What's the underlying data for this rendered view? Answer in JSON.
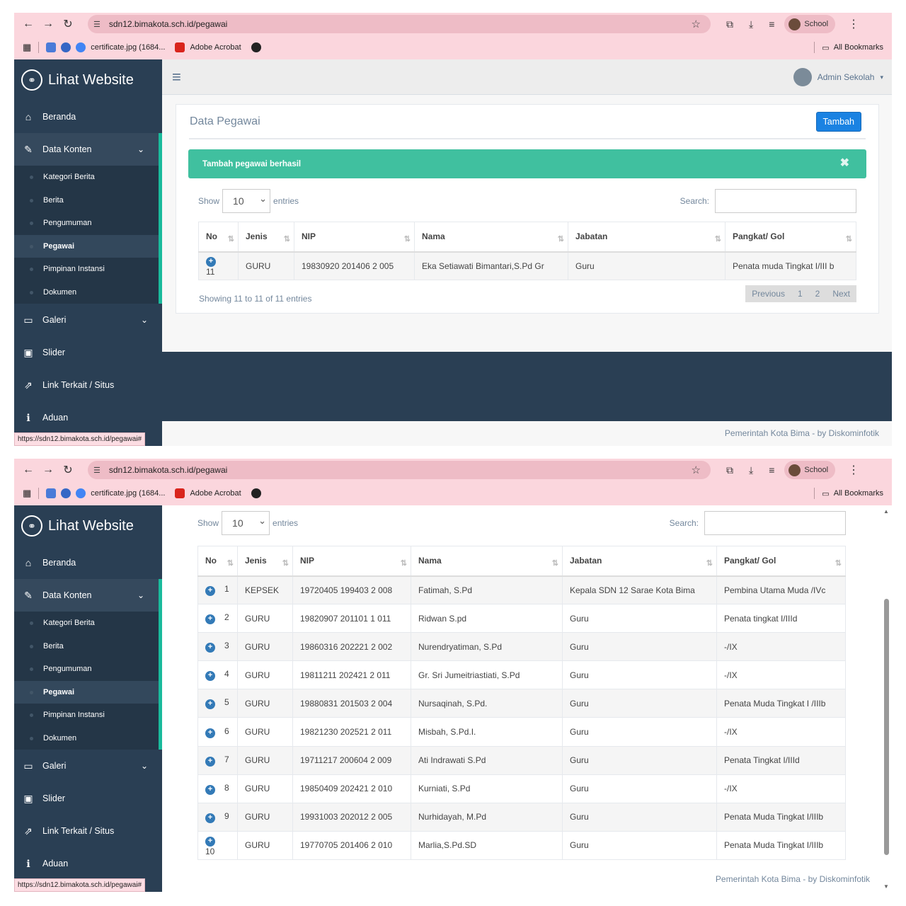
{
  "browser": {
    "url": "sdn12.bimakota.sch.id/pegawai",
    "profile": "School",
    "bookmarks": [
      "certificate.jpg (1684...",
      "Adobe Acrobat"
    ],
    "all_bookmarks": "All Bookmarks",
    "status_url": "https://sdn12.bimakota.sch.id/pegawai#"
  },
  "sidebar": {
    "logo": "Lihat Website",
    "beranda": "Beranda",
    "data_konten": "Data Konten",
    "sub": [
      "Kategori Berita",
      "Berita",
      "Pengumuman",
      "Pegawai",
      "Pimpinan Instansi",
      "Dokumen"
    ],
    "galeri": "Galeri",
    "slider": "Slider",
    "link_terkait": "Link Terkait / Situs",
    "aduan": "Aduan"
  },
  "topnav": {
    "user": "Admin Sekolah"
  },
  "panel": {
    "title": "Data Pegawai",
    "add_button": "Tambah",
    "alert": "Tambah pegawai berhasil"
  },
  "table_controls": {
    "show": "Show",
    "entries_value": "10",
    "entries": "entries",
    "search": "Search:"
  },
  "columns": [
    "No",
    "Jenis",
    "NIP",
    "Nama",
    "Jabatan",
    "Pangkat/ Gol"
  ],
  "page2_rows": [
    {
      "no": "11",
      "jenis": "GURU",
      "nip": "19830920 201406 2 005",
      "nama": "Eka Setiawati Bimantari,S.Pd Gr",
      "jabatan": "Guru",
      "pangkat": "Penata muda Tingkat I/III b"
    }
  ],
  "page1_rows": [
    {
      "no": "1",
      "jenis": "KEPSEK",
      "nip": "19720405 199403 2 008",
      "nama": "Fatimah, S.Pd",
      "jabatan": "Kepala SDN 12 Sarae Kota Bima",
      "pangkat": "Pembina Utama Muda /IVc"
    },
    {
      "no": "2",
      "jenis": "GURU",
      "nip": "19820907 201101 1 011",
      "nama": "Ridwan S.pd",
      "jabatan": "Guru",
      "pangkat": "Penata tingkat I/IIId"
    },
    {
      "no": "3",
      "jenis": "GURU",
      "nip": "19860316 202221 2 002",
      "nama": "Nurendryatiman, S.Pd",
      "jabatan": "Guru",
      "pangkat": "-/IX"
    },
    {
      "no": "4",
      "jenis": "GURU",
      "nip": "19811211 202421 2 011",
      "nama": "Gr. Sri Jumeitriastiati, S.Pd",
      "jabatan": "Guru",
      "pangkat": "-/IX"
    },
    {
      "no": "5",
      "jenis": "GURU",
      "nip": "19880831 201503 2 004",
      "nama": "Nursaqinah, S.Pd.",
      "jabatan": "Guru",
      "pangkat": "Penata Muda Tingkat I /IIIb"
    },
    {
      "no": "6",
      "jenis": "GURU",
      "nip": "19821230 202521 2 011",
      "nama": "Misbah, S.Pd.I.",
      "jabatan": "Guru",
      "pangkat": "-/IX"
    },
    {
      "no": "7",
      "jenis": "GURU",
      "nip": "19711217 200604 2 009",
      "nama": "Ati Indrawati S.Pd",
      "jabatan": "Guru",
      "pangkat": "Penata Tingkat I/IIId"
    },
    {
      "no": "8",
      "jenis": "GURU",
      "nip": "19850409 202421 2 010",
      "nama": "Kurniati, S.Pd",
      "jabatan": "Guru",
      "pangkat": "-/IX"
    },
    {
      "no": "9",
      "jenis": "GURU",
      "nip": "19931003 202012 2 005",
      "nama": "Nurhidayah, M.Pd",
      "jabatan": "Guru",
      "pangkat": "Penata Muda Tingkat I/IIIb"
    },
    {
      "no": "10",
      "jenis": "GURU",
      "nip": "19770705 201406 2 010",
      "nama": "Marlia,S.Pd.SD",
      "jabatan": "Guru",
      "pangkat": "Penata Muda Tingkat I/IIIb"
    }
  ],
  "pagination": {
    "info": "Showing 11 to 11 of 11 entries",
    "previous": "Previous",
    "pages": [
      "1",
      "2"
    ],
    "next": "Next"
  },
  "footer": "Pemerintah Kota Bima - by Diskominfotik",
  "colors": {
    "sidebar": "#2a3f54",
    "alert": "#40c09f",
    "primary": "#1a82e2",
    "browser": "#fbd6dd"
  },
  "icons": [
    "back-icon",
    "forward-icon",
    "reload-icon",
    "site-settings-icon",
    "star-icon",
    "extensions-icon",
    "download-icon",
    "reading-list-icon",
    "menu-dots-icon",
    "apps-icon",
    "folder-icon",
    "home-icon",
    "edit-icon",
    "monitor-icon",
    "image-icon",
    "external-link-icon",
    "info-icon",
    "hamburger-icon",
    "close-icon",
    "expand-plus-icon"
  ]
}
